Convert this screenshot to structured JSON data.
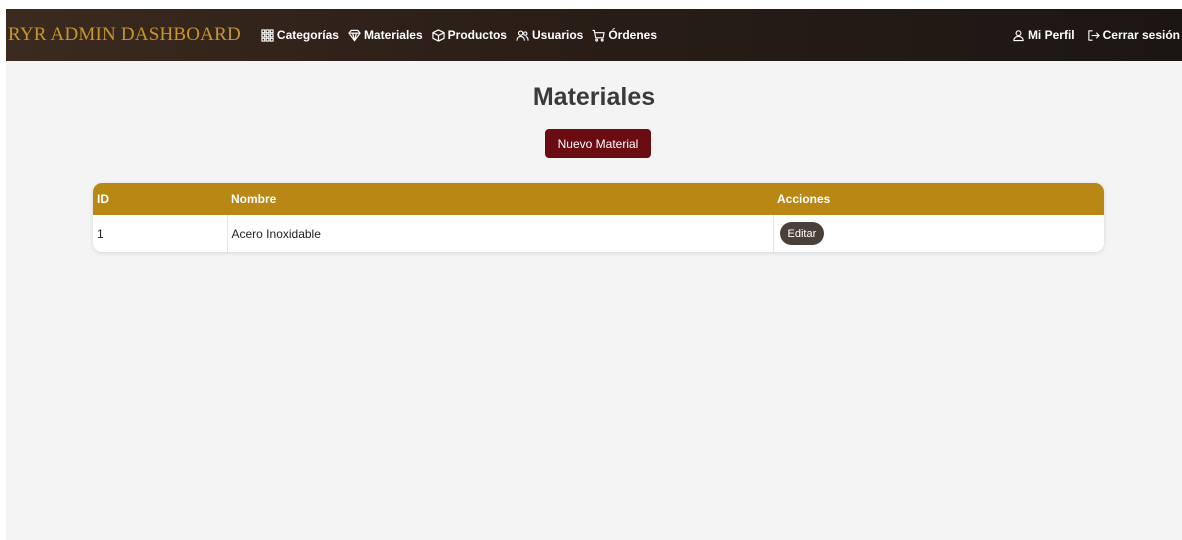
{
  "navbar": {
    "brand": "RYR ADMIN DASHBOARD",
    "links": [
      {
        "label": "Categorías",
        "icon": "grid-icon"
      },
      {
        "label": "Materiales",
        "icon": "gem-icon"
      },
      {
        "label": "Productos",
        "icon": "box-icon"
      },
      {
        "label": "Usuarios",
        "icon": "users-icon"
      },
      {
        "label": "Órdenes",
        "icon": "cart-icon"
      }
    ],
    "right": [
      {
        "label": "Mi Perfil",
        "icon": "user-icon"
      },
      {
        "label": "Cerrar sesión",
        "icon": "logout-icon"
      }
    ]
  },
  "page": {
    "title": "Materiales",
    "new_button_label": "Nuevo Material"
  },
  "table": {
    "columns": [
      "ID",
      "Nombre",
      "Acciones"
    ],
    "rows": [
      {
        "id": "1",
        "name": "Acero Inoxidable",
        "action_label": "Editar"
      }
    ]
  },
  "colors": {
    "navbar_bg": "#2a1e17",
    "brand": "#c8962a",
    "table_header": "#b88714",
    "primary_button": "#6b0c12",
    "edit_button": "#4a403a",
    "page_bg": "#f4f4f4"
  }
}
